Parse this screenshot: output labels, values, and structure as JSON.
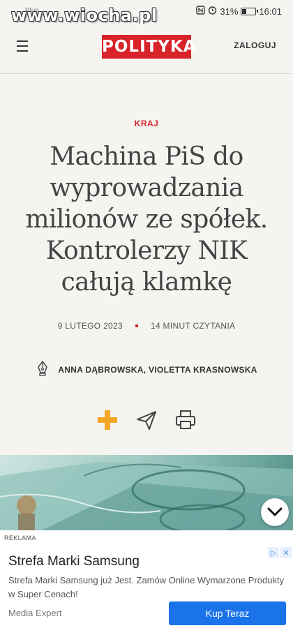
{
  "status_bar": {
    "carrier": "Plus",
    "battery_percent": "31%",
    "battery_level": 0.31,
    "time": "16:01"
  },
  "watermark": "www.wiocha.pl",
  "header": {
    "logo": "POLITYKA",
    "login_label": "ZALOGUJ"
  },
  "article": {
    "category": "KRAJ",
    "title": "Machina PiS do wyprowadzania milionów ze spółek. Kontrolerzy NIK całują klamkę",
    "date": "9 LUTEGO 2023",
    "reading_time": "14 MINUT CZYTANIA",
    "authors": "ANNA DĄBROWSKA, VIOLETTA KRASNOWSKA"
  },
  "ad": {
    "label": "REKLAMA",
    "title": "Strefa Marki Samsung",
    "description": "Strefa Marki Samsung już Jest. Zamów Online Wymarzone Produkty w Super Cenach!",
    "advertiser": "Media Expert",
    "cta": "Kup Teraz"
  },
  "colors": {
    "brand_red": "#d8232a",
    "accent_orange": "#f5a623",
    "cta_blue": "#1a73e8"
  }
}
